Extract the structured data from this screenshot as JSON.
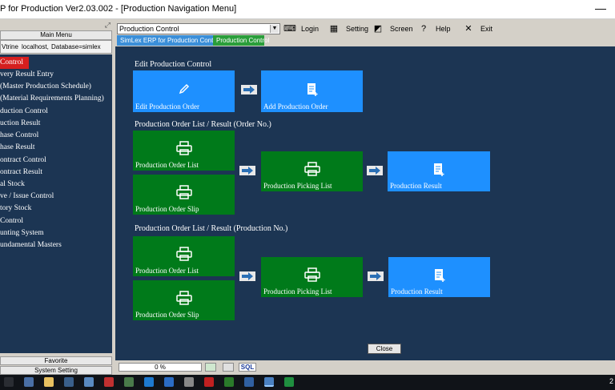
{
  "window": {
    "title": "P for Production Ver2.03.002 - [Production Navigation Menu]",
    "minimize": "—"
  },
  "toolbar": {
    "module_select": "Production Control",
    "buttons": [
      {
        "label": "Login",
        "icon": "login-icon"
      },
      {
        "label": "Setting",
        "icon": "setting-icon"
      },
      {
        "label": "Screen",
        "icon": "screen-icon"
      },
      {
        "label": "Help",
        "icon": "help-icon"
      },
      {
        "label": "Exit",
        "icon": "exit-icon"
      }
    ]
  },
  "sidebar": {
    "header": "Main Menu",
    "connection": {
      "user": "Vtrine",
      "server": "localhost,",
      "database": "Database=simlex"
    },
    "items": [
      "Control",
      "very Result Entry",
      "(Master Production Schedule)",
      "(Material Requirements Planning)",
      "duction Control",
      "uction Result",
      "hase Control",
      "hase Result",
      "ontract Control",
      "ontract Result",
      "al Stock",
      "ve / Issue Control",
      "tory Stock",
      " Control",
      "unting System",
      "undamental Masters"
    ],
    "favorite": "Favorite",
    "system_setting": "System Setting"
  },
  "tabs": [
    "SimLex ERP for Production Control",
    "Production Control"
  ],
  "main": {
    "sections": [
      "Edit Production Control",
      "Production Order List / Result (Order No.)",
      "Production Order List / Result (Production No.)"
    ],
    "cards": {
      "edit_order": "Edit Production Order",
      "add_order": "Add Production Order",
      "order_list_1": "Production Order List",
      "order_slip_1": "Production Order Slip",
      "picking_1": "Production Picking List",
      "result_1": "Production Result",
      "order_list_2": "Production Order List",
      "order_slip_2": "Production Order Slip",
      "picking_2": "Production Picking List",
      "result_2": "Production Result"
    },
    "close": "Close"
  },
  "status": {
    "progress": "0 %",
    "sql": "SQL"
  },
  "taskbar": {
    "clock": "2"
  },
  "colors": {
    "panel": "#1c3553",
    "blue_card": "#1e90ff",
    "green_card": "#007a1a",
    "selected": "#d51f1f"
  }
}
